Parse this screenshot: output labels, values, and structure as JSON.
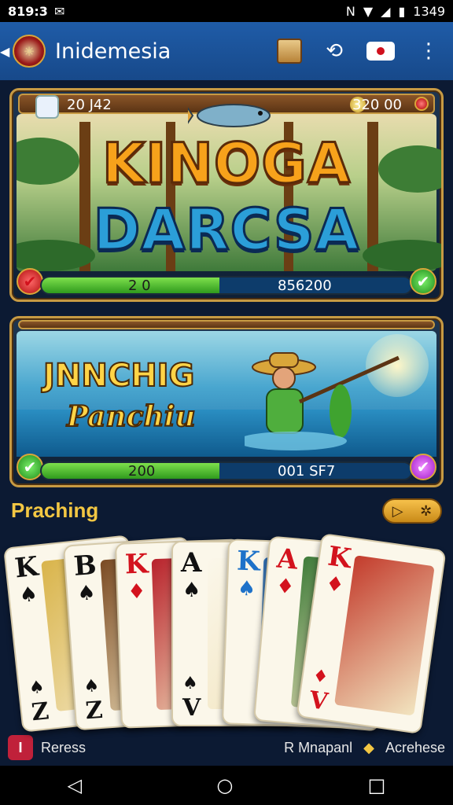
{
  "status_bar": {
    "time": "819:3",
    "battery": "1349"
  },
  "app_bar": {
    "title": "Inidemesia"
  },
  "banner1": {
    "left_value": "20 J42",
    "right_value": "320 00",
    "title_line1": "KINOGA",
    "title_line2": "DARCSA",
    "progress_left": "2 0",
    "progress_right": "856200",
    "progress_fraction": 0.48
  },
  "banner2": {
    "title_line1": "JNNCHIG",
    "title_line2": "Panchiu",
    "progress_left": "200",
    "progress_right": "001 SF7",
    "progress_fraction": 0.48
  },
  "section": {
    "title": "Praching"
  },
  "cards": [
    {
      "rank": "K",
      "suit": "♠",
      "color": "black",
      "bottom": "Z"
    },
    {
      "rank": "B",
      "suit": "♠",
      "color": "black",
      "bottom": "Z"
    },
    {
      "rank": "K",
      "suit": "♦",
      "color": "red",
      "bottom": ""
    },
    {
      "rank": "A",
      "suit": "♠",
      "color": "black",
      "bottom": "V"
    },
    {
      "rank": "K",
      "suit": "♠",
      "color": "blue",
      "bottom": ""
    },
    {
      "rank": "A",
      "suit": "♦",
      "color": "red",
      "bottom": ""
    },
    {
      "rank": "K",
      "suit": "♦",
      "color": "red",
      "bottom": "V"
    }
  ],
  "footer": {
    "badge": "I",
    "left_text": "Reress",
    "mid_text": "R Mnapanl",
    "right_text": "Acrehese"
  }
}
